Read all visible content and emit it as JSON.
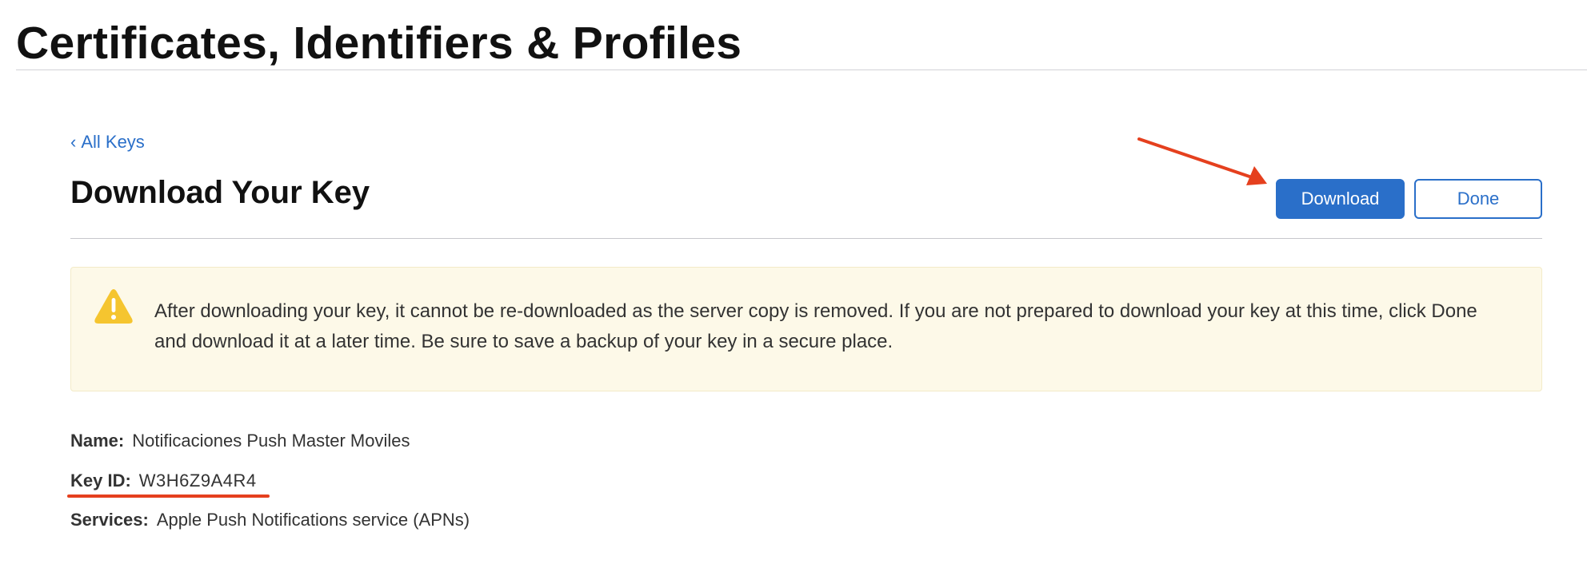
{
  "header": {
    "title": "Certificates, Identifiers & Profiles"
  },
  "nav": {
    "back_chevron": "‹",
    "back_label": "All Keys"
  },
  "main": {
    "title": "Download Your Key",
    "buttons": {
      "download_label": "Download",
      "done_label": "Done"
    },
    "warning": {
      "icon": "warning-triangle-icon",
      "text": "After downloading your key, it cannot be re-downloaded as the server copy is removed. If you are not prepared to download your key at this time, click Done and download it at a later time. Be sure to save a backup of your key in a secure place."
    },
    "details": {
      "name_label": "Name:",
      "name_value": "Notificaciones Push Master Moviles",
      "key_id_label": "Key ID:",
      "key_id_value": "W3H6Z9A4R4",
      "services_label": "Services:",
      "services_value": "Apple Push Notifications service (APNs)"
    }
  },
  "annotations": {
    "highlight_color": "#e5401e"
  },
  "colors": {
    "accent": "#2a6fc9",
    "warning_bg": "#fdf9e8",
    "warning_icon": "#f5c52f"
  }
}
